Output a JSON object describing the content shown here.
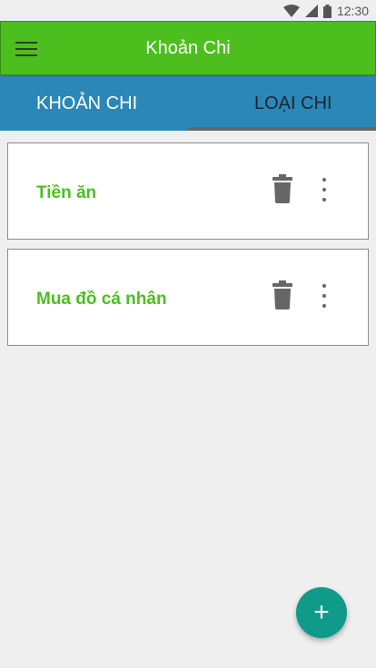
{
  "status_bar": {
    "time": "12:30",
    "icons": [
      "wifi-icon",
      "signal-icon",
      "battery-icon"
    ]
  },
  "app_bar": {
    "title": "Khoản Chi",
    "menu_icon": "hamburger-menu-icon",
    "color": "#4cbf1f"
  },
  "tabs": [
    {
      "label": "KHOẢN CHI",
      "selected": false
    },
    {
      "label": "LOẠI CHI",
      "selected": true
    }
  ],
  "tab_bar_color": "#2a87b8",
  "items": [
    {
      "title": "Tiền ăn",
      "delete_icon": "trash-icon",
      "more_icon": "more-vert-icon"
    },
    {
      "title": "Mua đồ cá nhân",
      "delete_icon": "trash-icon",
      "more_icon": "more-vert-icon"
    }
  ],
  "fab": {
    "label": "+",
    "icon": "add-icon",
    "color": "#109a8a"
  }
}
